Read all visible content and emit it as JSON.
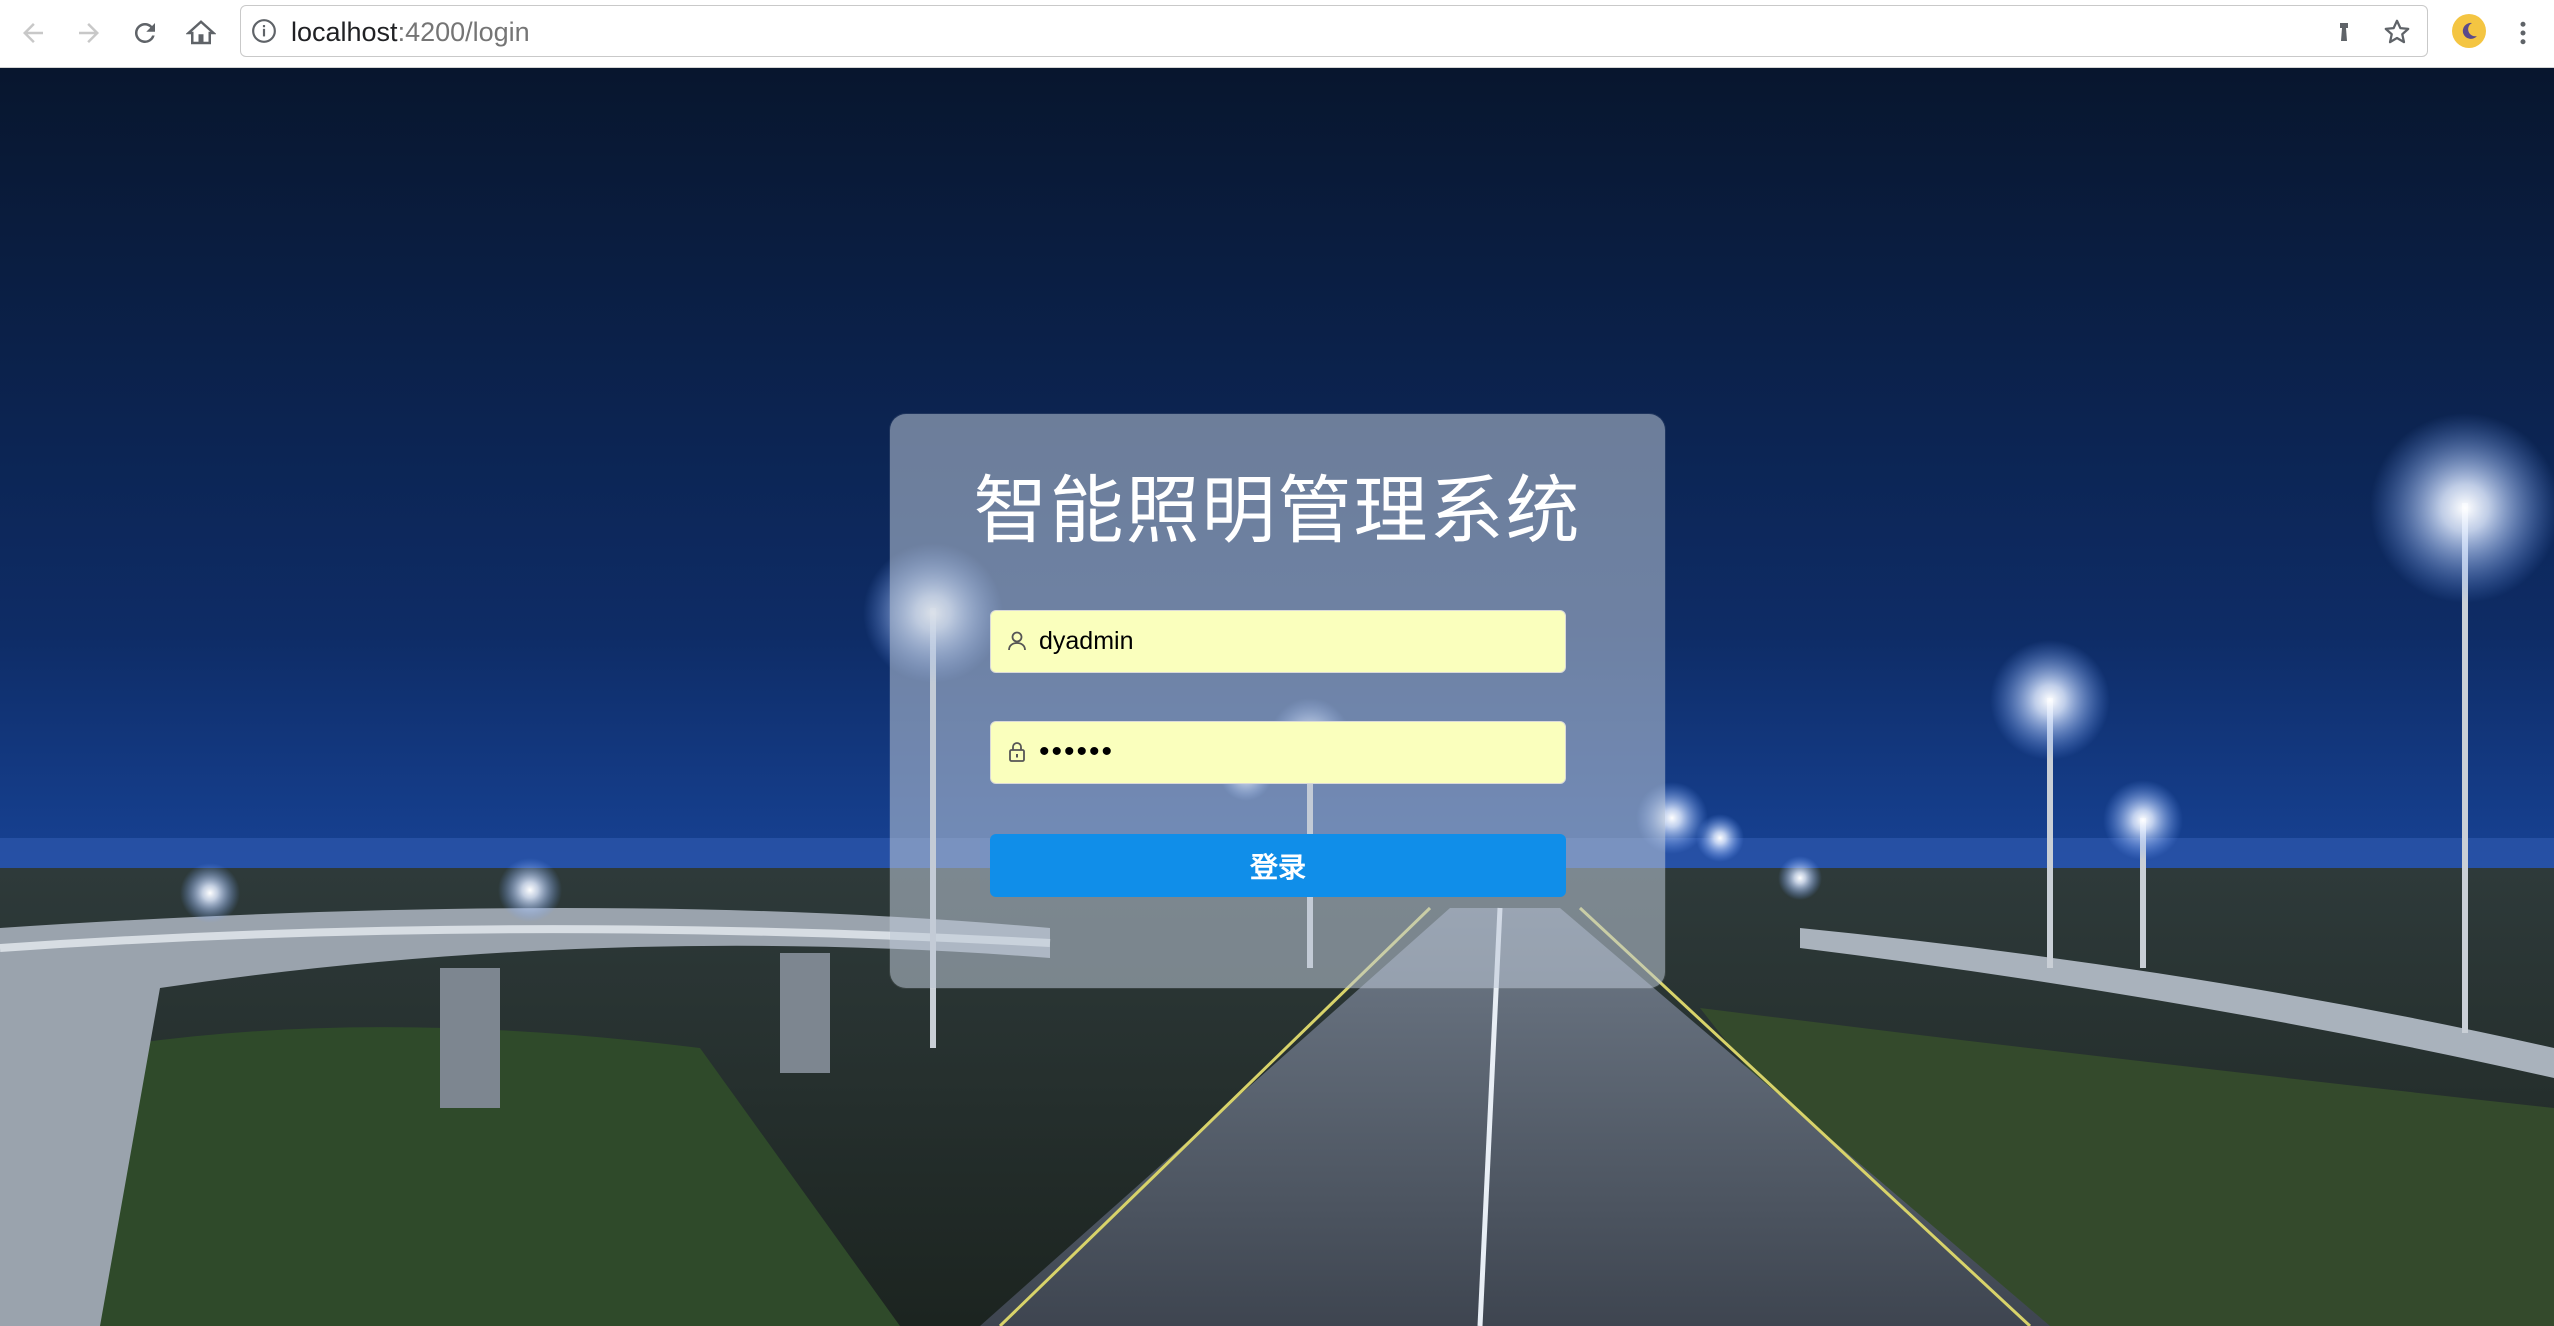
{
  "browser": {
    "url_host": "localhost",
    "url_rest": ":4200/login",
    "icons": [
      "back-icon",
      "forward-icon",
      "reload-icon",
      "home-icon",
      "info-icon",
      "lighthouse-icon",
      "star-icon",
      "moon-extension-icon",
      "more-vert-icon"
    ]
  },
  "login": {
    "title": "智能照明管理系统",
    "username_value": "dyadmin",
    "password_value": "••••••",
    "submit_label": "登录"
  },
  "colors": {
    "primary": "#108ee9",
    "autofill": "#faffbd",
    "card": "rgba(190,200,215,0.55)"
  }
}
